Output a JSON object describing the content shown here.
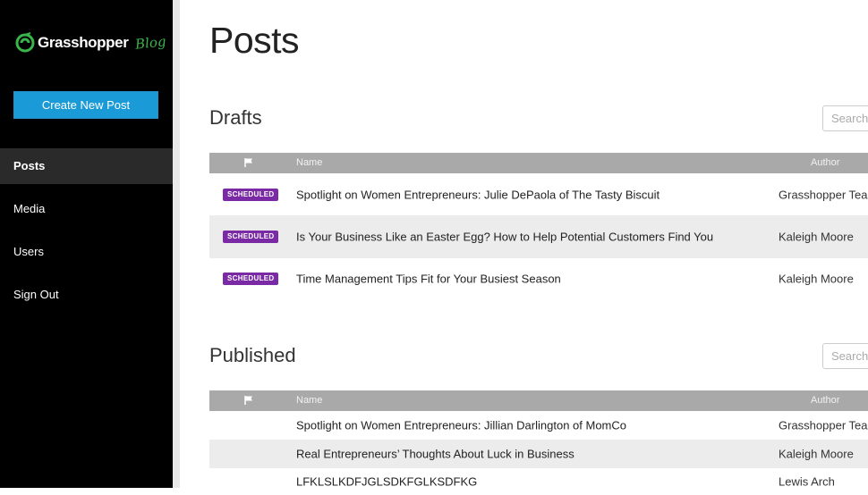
{
  "brand": {
    "name": "Grasshopper",
    "tag": "Blog"
  },
  "sidebar": {
    "create_label": "Create New Post",
    "items": [
      {
        "label": "Posts",
        "active": true
      },
      {
        "label": "Media"
      },
      {
        "label": "Users"
      },
      {
        "label": "Sign Out"
      }
    ]
  },
  "main": {
    "title": "Posts",
    "drafts": {
      "title": "Drafts",
      "search_placeholder": "Search",
      "columns": {
        "name": "Name",
        "author": "Author"
      },
      "rows": [
        {
          "badge": "SCHEDULED",
          "title": "Spotlight on Women Entrepreneurs: Julie DePaola of The Tasty Biscuit",
          "author": "Grasshopper Tear"
        },
        {
          "badge": "SCHEDULED",
          "title": "Is Your Business Like an Easter Egg? How to Help Potential Customers Find You",
          "author": "Kaleigh Moore"
        },
        {
          "badge": "SCHEDULED",
          "title": "Time Management Tips Fit for Your Busiest Season",
          "author": "Kaleigh Moore"
        }
      ]
    },
    "published": {
      "title": "Published",
      "search_placeholder": "Search",
      "columns": {
        "name": "Name",
        "author": "Author"
      },
      "rows": [
        {
          "title": "Spotlight on Women Entrepreneurs: Jillian Darlington of MomCo",
          "author": "Grasshopper Tear"
        },
        {
          "title": "Real Entrepreneurs’ Thoughts About Luck in Business",
          "author": "Kaleigh Moore"
        },
        {
          "title": "LFKLSLKDFJGLSDKFGLKSDFKG",
          "author": "Lewis Arch"
        }
      ]
    }
  },
  "colors": {
    "accent": "#1a9ad6",
    "badge": "#7b2aa6",
    "brand_green": "#39b54a",
    "sidebar": "#000000"
  },
  "icons": {
    "flag": "flag-icon",
    "logo": "grasshopper-logo-icon"
  }
}
